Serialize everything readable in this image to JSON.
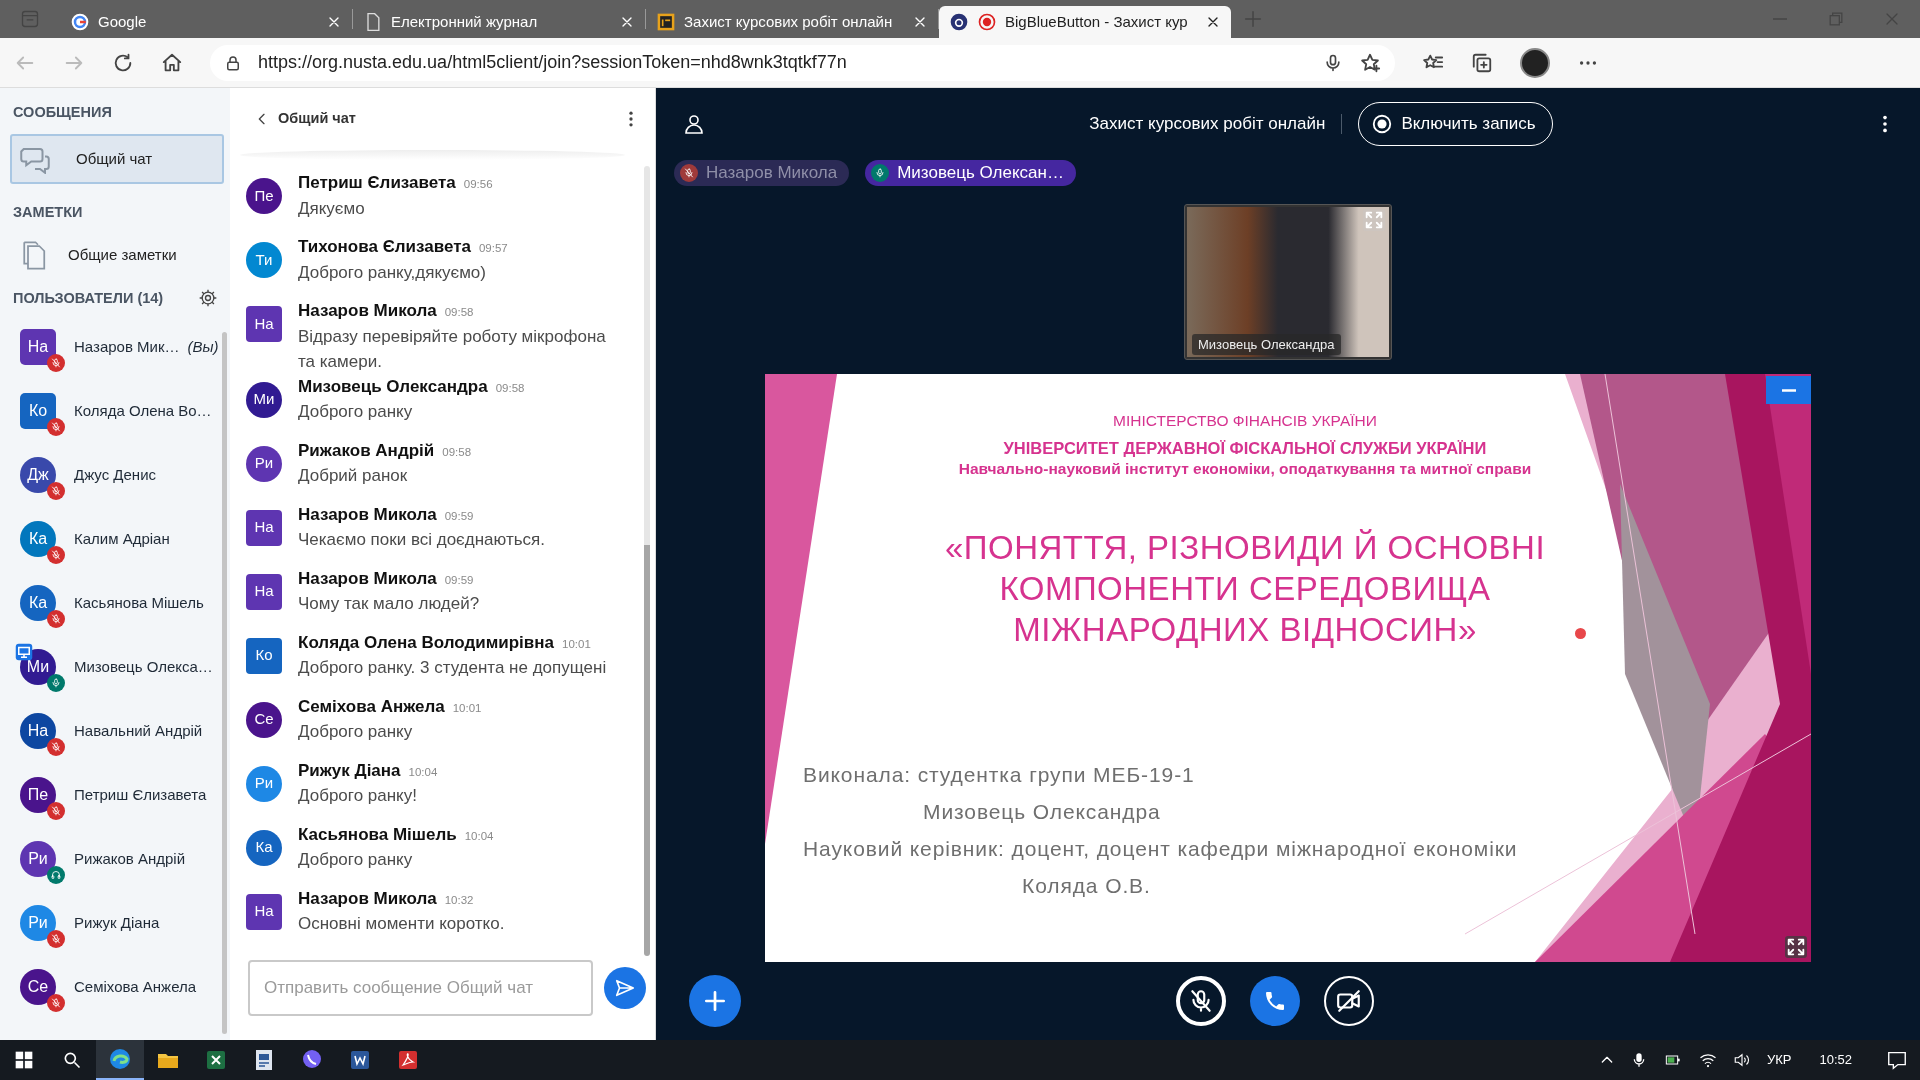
{
  "browser": {
    "tabs": [
      {
        "kind": "google",
        "label": "Google",
        "selected": false
      },
      {
        "kind": "document",
        "label": "Електронний журнал",
        "selected": false
      },
      {
        "kind": "logo",
        "label": "Захист курсових робіт онлайн",
        "selected": false
      },
      {
        "kind": "bbb",
        "label": "BigBlueButton - Захист кур",
        "selected": true
      }
    ],
    "url": "https://org.nusta.edu.ua/html5client/join?sessionToken=nhd8wnk3tqtkf77n"
  },
  "sidebar": {
    "messages_heading": "СООБЩЕНИЯ",
    "public_chat": {
      "label": "Общий чат",
      "selected": true
    },
    "notes_heading": "ЗАМЕТКИ",
    "shared_notes": "Общие заметки",
    "users_heading": "ПОЛЬЗОВАТЕЛИ",
    "users_count": "(14)",
    "users": [
      {
        "initials": "На",
        "name": "Назаров Мик…",
        "you": "(Вы)",
        "color": "#5e35b1",
        "moderator": true,
        "muted": true,
        "listen_only": false,
        "presenter": false
      },
      {
        "initials": "Ко",
        "name": "Коляда Олена Во…",
        "color": "#1565c0",
        "moderator": true,
        "muted": true,
        "listen_only": false,
        "presenter": false
      },
      {
        "initials": "Дж",
        "name": "Джус Денис",
        "color": "#3949ab",
        "moderator": false,
        "muted": true,
        "listen_only": false,
        "presenter": false
      },
      {
        "initials": "Ка",
        "name": "Калим Адріан",
        "color": "#0277bd",
        "moderator": false,
        "muted": true,
        "listen_only": false,
        "presenter": false
      },
      {
        "initials": "Ка",
        "name": "Касьянова Мішель",
        "color": "#1565c0",
        "moderator": false,
        "muted": true,
        "listen_only": false,
        "presenter": false
      },
      {
        "initials": "Ми",
        "name": "Мизовець Олекса…",
        "color": "#311b92",
        "moderator": false,
        "muted": false,
        "listen_only": false,
        "presenter": true
      },
      {
        "initials": "На",
        "name": "Навальний Андрій",
        "color": "#0d47a1",
        "moderator": false,
        "muted": true,
        "listen_only": false,
        "presenter": false
      },
      {
        "initials": "Пе",
        "name": "Петриш Єлизавета",
        "color": "#4a148c",
        "moderator": false,
        "muted": true,
        "listen_only": false,
        "presenter": false
      },
      {
        "initials": "Ри",
        "name": "Рижаков Андрій",
        "color": "#5e35b1",
        "moderator": false,
        "muted": false,
        "listen_only": true,
        "presenter": false
      },
      {
        "initials": "Ри",
        "name": "Рижук Діана",
        "color": "#1e88e5",
        "moderator": false,
        "muted": true,
        "listen_only": false,
        "presenter": false
      },
      {
        "initials": "Се",
        "name": "Семіхова Анжела",
        "color": "#4a148c",
        "moderator": false,
        "muted": true,
        "listen_only": false,
        "presenter": false
      }
    ]
  },
  "chat": {
    "title": "Общий чат",
    "messages": [
      {
        "initials": "Пе",
        "color": "#4a148c",
        "moderator": false,
        "name": "Петриш Єлизавета",
        "time": "09:56",
        "text": "Дякуємо"
      },
      {
        "initials": "Ти",
        "color": "#0288d1",
        "moderator": false,
        "name": "Тихонова Єлизавета",
        "time": "09:57",
        "text": "Доброго ранку,дякуємо)"
      },
      {
        "initials": "На",
        "color": "#5e35b1",
        "moderator": true,
        "name": "Назаров Микола",
        "time": "09:58",
        "text": "Відразу перевіряйте роботу мікрофона та камери."
      },
      {
        "initials": "Ми",
        "color": "#311b92",
        "moderator": false,
        "name": "Мизовець Олександра",
        "time": "09:58",
        "text": "Доброго ранку"
      },
      {
        "initials": "Ри",
        "color": "#5e35b1",
        "moderator": false,
        "name": "Рижаков Андрій",
        "time": "09:58",
        "text": "Добрий ранок"
      },
      {
        "initials": "На",
        "color": "#5e35b1",
        "moderator": true,
        "name": "Назаров Микола",
        "time": "09:59",
        "text": "Чекаємо поки всі доєднаються."
      },
      {
        "initials": "На",
        "color": "#5e35b1",
        "moderator": true,
        "name": "Назаров Микола",
        "time": "09:59",
        "text": "Чому так мало людей?"
      },
      {
        "initials": "Ко",
        "color": "#1565c0",
        "moderator": true,
        "name": "Коляда Олена Володимирівна",
        "time": "10:01",
        "text": "Доброго ранку. 3 студента не допущені"
      },
      {
        "initials": "Се",
        "color": "#4a148c",
        "moderator": false,
        "name": "Семіхова Анжела",
        "time": "10:01",
        "text": "Доброго ранку"
      },
      {
        "initials": "Ри",
        "color": "#1e88e5",
        "moderator": false,
        "name": "Рижук Діана",
        "time": "10:04",
        "text": "Доброго ранку!"
      },
      {
        "initials": "Ка",
        "color": "#1565c0",
        "moderator": false,
        "name": "Касьянова Мішель",
        "time": "10:04",
        "text": "Доброго ранку"
      },
      {
        "initials": "На",
        "color": "#5e35b1",
        "moderator": true,
        "name": "Назаров Микола",
        "time": "10:32",
        "text": "Основні моменти коротко."
      }
    ],
    "placeholder": "Отправить сообщение Общий чат"
  },
  "meeting": {
    "title": "Захист курсових робіт онлайн",
    "record_label": "Включить запись",
    "talkers": [
      {
        "name": "Назаров Микола",
        "talking": false,
        "muted": true
      },
      {
        "name": "Мизовець Олексан…",
        "talking": true,
        "muted": false
      }
    ],
    "video": {
      "caption": "Мизовець Олександра"
    },
    "slide": {
      "header": [
        {
          "kind": "ministry",
          "text": "МІНІСТЕРСТВО ФІНАНСІВ УКРАЇНИ"
        },
        {
          "kind": "university",
          "text": "УНІВЕРСИТЕТ ДЕРЖАВНОЇ ФІСКАЛЬНОЇ СЛУЖБИ УКРАЇНИ"
        },
        {
          "kind": "institute",
          "text": "Навчально-науковий інститут економіки, оподаткування та митної справи"
        }
      ],
      "title": "«ПОНЯТТЯ, РІЗНОВИДИ Й ОСНОВНІ\nКОМПОНЕНТИ СЕРЕДОВИЩА\nМІЖНАРОДНИХ ВІДНОСИН»",
      "credits": [
        {
          "label": "Виконала: студентка групи МЕБ-19-1",
          "name": "Мизовець Олександра"
        },
        {
          "label": "Науковий керівник: доцент, доцент кафедри міжнародної економіки",
          "name": "Коляда О.В."
        }
      ]
    },
    "controls": [
      {
        "kind": "mic",
        "muted": true
      },
      {
        "kind": "phone"
      },
      {
        "kind": "camera",
        "on": false
      }
    ]
  },
  "taskbar": {
    "apps": [
      {
        "kind": "edge",
        "active": true
      },
      {
        "kind": "explorer",
        "active": false
      },
      {
        "kind": "excel",
        "active": false
      },
      {
        "kind": "app",
        "active": false
      },
      {
        "kind": "viber",
        "active": false
      },
      {
        "kind": "word",
        "active": false
      },
      {
        "kind": "acrobat",
        "active": false
      }
    ],
    "language": "УКР",
    "time": "10:52"
  }
}
